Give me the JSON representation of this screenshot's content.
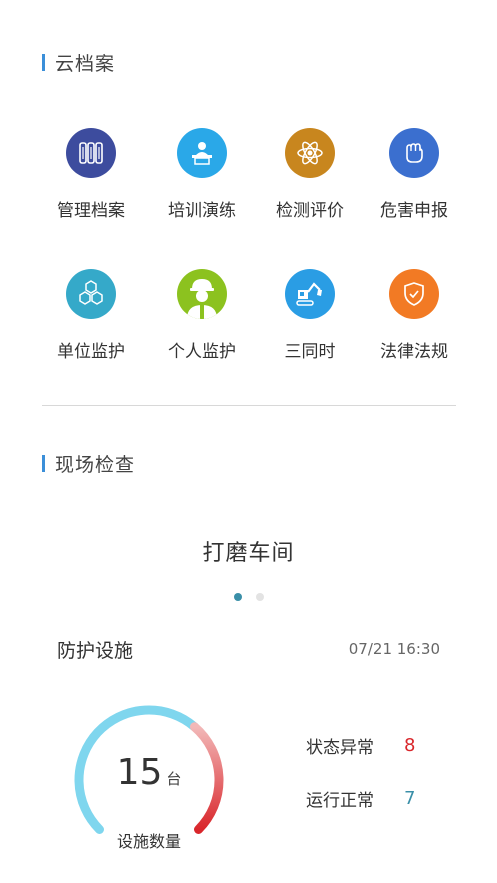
{
  "cloud_archive": {
    "title": "云档案",
    "items": [
      {
        "label": "管理档案",
        "icon": "archive-binders-icon",
        "color": "#3d4c9e"
      },
      {
        "label": "培训演练",
        "icon": "training-lecture-icon",
        "color": "#2aa8e8"
      },
      {
        "label": "检测评价",
        "icon": "atom-detection-icon",
        "color": "#c8861e"
      },
      {
        "label": "危害申报",
        "icon": "fist-report-icon",
        "color": "#3b6fcf"
      },
      {
        "label": "单位监护",
        "icon": "hexagon-cluster-icon",
        "color": "#35a9c9"
      },
      {
        "label": "个人监护",
        "icon": "worker-helmet-icon",
        "color": "#8cc21f"
      },
      {
        "label": "三同时",
        "icon": "excavator-icon",
        "color": "#2a9de4"
      },
      {
        "label": "法律法规",
        "icon": "shield-check-icon",
        "color": "#f27a24"
      }
    ]
  },
  "site_inspection": {
    "title": "现场检查",
    "slide_title": "打磨车间",
    "dots": {
      "count": 2,
      "active": 0,
      "active_color": "#3a8fa8",
      "inactive_color": "#e3e3e3"
    }
  },
  "protection": {
    "title": "防护设施",
    "timestamp": "07/21 16:30",
    "gauge": {
      "count": "15",
      "unit": "台",
      "label": "设施数量",
      "abnormal_fraction": 0.35
    },
    "stats": [
      {
        "label": "状态异常",
        "value": "8",
        "color": "#d9262b"
      },
      {
        "label": "运行正常",
        "value": "7",
        "color": "#3a8fa8"
      }
    ]
  }
}
